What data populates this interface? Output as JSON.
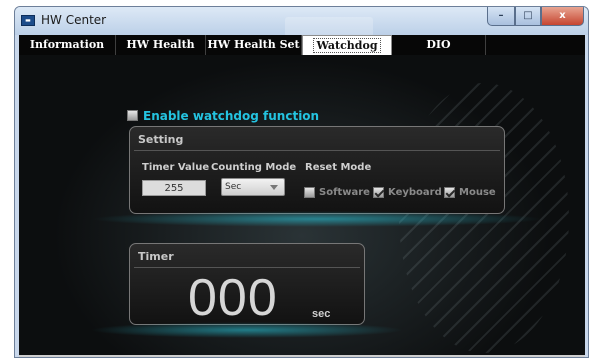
{
  "window": {
    "title": "HW Center",
    "controls": {
      "minimize": "–",
      "maximize": "□",
      "close": "x"
    }
  },
  "tabs": [
    {
      "label": "Information",
      "active": false
    },
    {
      "label": "HW Health",
      "active": false
    },
    {
      "label": "HW Health Set",
      "active": false
    },
    {
      "label": "Watchdog",
      "active": true
    },
    {
      "label": "DIO",
      "active": false
    }
  ],
  "watchdog": {
    "enable_label": "Enable watchdog function",
    "enable_checked": false,
    "setting": {
      "title": "Setting",
      "timer_value_header": "Timer Value",
      "counting_mode_header": "Counting Mode",
      "reset_mode_header": "Reset  Mode",
      "timer_value": "255",
      "counting_mode": "Sec",
      "reset_options": [
        {
          "label": "Software",
          "checked": false
        },
        {
          "label": "Keyboard",
          "checked": true
        },
        {
          "label": "Mouse",
          "checked": true
        }
      ]
    },
    "timer": {
      "title": "Timer",
      "value": "000",
      "unit": "sec"
    }
  },
  "colors": {
    "accent": "#24c3e0",
    "panel_bg": "#1a1a1a",
    "tab_bar": "#070707"
  }
}
